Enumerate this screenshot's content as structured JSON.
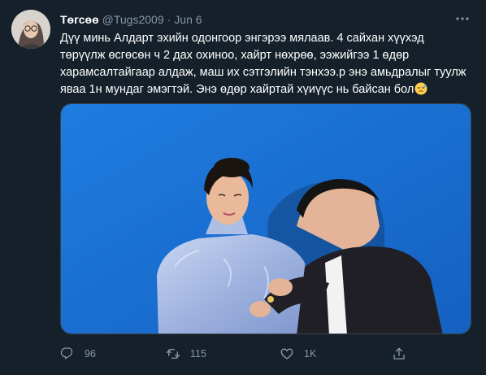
{
  "tweet": {
    "author_name": "Төгсөө",
    "handle": "@Tugs2009",
    "separator": "·",
    "date": "Jun 6",
    "text_lines": [
      "Дүү минь Алдарт эхийн одонгоор энгэрээ мялаав. 4 сайхан хүүхэд",
      "төрүүлж өсгөсөн ч 2 дах охиноо, хайрт нөхрөө, ээжийгээ 1 өдөр",
      "харамсалтайгаар алдаж, маш их сэтгэлийн тэнхээ.р энэ амьдралыг туулж",
      "яваа 1н мундаг эмэгтэй. Энэ өдөр хайртай хүиүүс нь байсан бол"
    ]
  },
  "actions": {
    "reply_count": "96",
    "retweet_count": "115",
    "like_count": "1K"
  },
  "icons": {
    "more": "more-dots-icon",
    "reply": "reply-icon",
    "retweet": "retweet-icon",
    "like": "heart-icon",
    "share": "share-icon",
    "emoji": "sad-relieved-face-emoji"
  },
  "colors": {
    "background": "#15202b",
    "muted": "#8899a6",
    "border": "#38444d",
    "photo_backdrop": "#1a6fd0"
  }
}
